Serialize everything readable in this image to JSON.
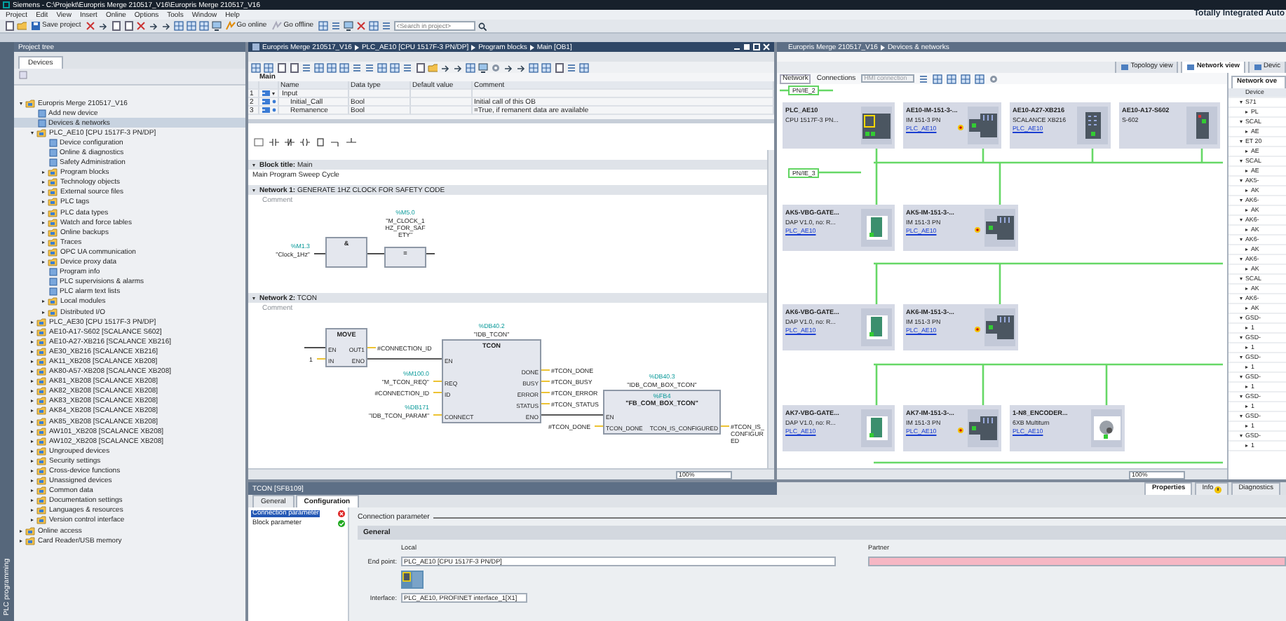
{
  "title_bar": {
    "title": "Siemens - C:\\Projekt\\Europris Merge 210517_V16\\Europris Merge 210517_V16"
  },
  "menu": [
    "Project",
    "Edit",
    "View",
    "Insert",
    "Online",
    "Options",
    "Tools",
    "Window",
    "Help"
  ],
  "brand": "Totally Integrated Auto",
  "toolbar": {
    "save_label": "Save project",
    "online_label": "Go online",
    "offline_label": "Go offline",
    "search_placeholder": "<Search in project>"
  },
  "side_tab": "PLC programming",
  "project_tree": {
    "title": "Project tree",
    "tab": "Devices",
    "items": [
      {
        "label": "Europris Merge 210517_V16",
        "kind": "node",
        "expanded": true,
        "selected": false,
        "children": [
          {
            "label": "Add new device",
            "kind": "leaf",
            "selected": false
          },
          {
            "label": "Devices & networks",
            "kind": "leaf",
            "selected": true
          },
          {
            "label": "PLC_AE10 [CPU 1517F-3 PN/DP]",
            "kind": "node",
            "expanded": true,
            "selected": false,
            "children": [
              {
                "label": "Device configuration",
                "kind": "leaf",
                "selected": false
              },
              {
                "label": "Online & diagnostics",
                "kind": "leaf",
                "selected": false
              },
              {
                "label": "Safety Administration",
                "kind": "leaf",
                "selected": false
              },
              {
                "label": "Program blocks",
                "kind": "node",
                "expanded": false,
                "selected": false
              },
              {
                "label": "Technology objects",
                "kind": "node",
                "expanded": false,
                "selected": false
              },
              {
                "label": "External source files",
                "kind": "node",
                "expanded": false,
                "selected": false
              },
              {
                "label": "PLC tags",
                "kind": "node",
                "expanded": false,
                "selected": false
              },
              {
                "label": "PLC data types",
                "kind": "node",
                "expanded": false,
                "selected": false
              },
              {
                "label": "Watch and force tables",
                "kind": "node",
                "expanded": false,
                "selected": false
              },
              {
                "label": "Online backups",
                "kind": "node",
                "expanded": false,
                "selected": false
              },
              {
                "label": "Traces",
                "kind": "node",
                "expanded": false,
                "selected": false
              },
              {
                "label": "OPC UA communication",
                "kind": "node",
                "expanded": false,
                "selected": false
              },
              {
                "label": "Device proxy data",
                "kind": "node",
                "expanded": false,
                "selected": false
              },
              {
                "label": "Program info",
                "kind": "leaf",
                "selected": false
              },
              {
                "label": "PLC supervisions & alarms",
                "kind": "leaf",
                "selected": false
              },
              {
                "label": "PLC alarm text lists",
                "kind": "leaf",
                "selected": false
              },
              {
                "label": "Local modules",
                "kind": "node",
                "expanded": false,
                "selected": false
              },
              {
                "label": "Distributed I/O",
                "kind": "node",
                "expanded": false,
                "selected": false
              }
            ]
          },
          {
            "label": "PLC_AE30 [CPU 1517F-3 PN/DP]",
            "kind": "node",
            "expanded": false,
            "selected": false
          },
          {
            "label": "AE10-A17-S602 [SCALANCE S602]",
            "kind": "node",
            "expanded": false,
            "selected": false
          },
          {
            "label": "AE10-A27-XB216 [SCALANCE XB216]",
            "kind": "node",
            "expanded": false,
            "selected": false
          },
          {
            "label": "AE30_XB216 [SCALANCE XB216]",
            "kind": "node",
            "expanded": false,
            "selected": false
          },
          {
            "label": "AK11_XB208 [SCALANCE XB208]",
            "kind": "node",
            "expanded": false,
            "selected": false
          },
          {
            "label": "AK80-A57-XB208 [SCALANCE XB208]",
            "kind": "node",
            "expanded": false,
            "selected": false
          },
          {
            "label": "AK81_XB208 [SCALANCE XB208]",
            "kind": "node",
            "expanded": false,
            "selected": false
          },
          {
            "label": "AK82_XB208 [SCALANCE XB208]",
            "kind": "node",
            "expanded": false,
            "selected": false
          },
          {
            "label": "AK83_XB208 [SCALANCE XB208]",
            "kind": "node",
            "expanded": false,
            "selected": false
          },
          {
            "label": "AK84_XB208 [SCALANCE XB208]",
            "kind": "node",
            "expanded": false,
            "selected": false
          },
          {
            "label": "AK85_XB208 [SCALANCE XB208]",
            "kind": "node",
            "expanded": false,
            "selected": false
          },
          {
            "label": "AW101_XB208 [SCALANCE XB208]",
            "kind": "node",
            "expanded": false,
            "selected": false
          },
          {
            "label": "AW102_XB208 [SCALANCE XB208]",
            "kind": "node",
            "expanded": false,
            "selected": false
          },
          {
            "label": "Ungrouped devices",
            "kind": "node",
            "expanded": false,
            "selected": false
          },
          {
            "label": "Security settings",
            "kind": "node",
            "expanded": false,
            "selected": false
          },
          {
            "label": "Cross-device functions",
            "kind": "node",
            "expanded": false,
            "selected": false
          },
          {
            "label": "Unassigned devices",
            "kind": "node",
            "expanded": false,
            "selected": false
          },
          {
            "label": "Common data",
            "kind": "node",
            "expanded": false,
            "selected": false
          },
          {
            "label": "Documentation settings",
            "kind": "node",
            "expanded": false,
            "selected": false
          },
          {
            "label": "Languages & resources",
            "kind": "node",
            "expanded": false,
            "selected": false
          },
          {
            "label": "Version control interface",
            "kind": "node",
            "expanded": false,
            "selected": false
          }
        ]
      },
      {
        "label": "Online access",
        "kind": "node",
        "expanded": false,
        "selected": false
      },
      {
        "label": "Card Reader/USB memory",
        "kind": "node",
        "expanded": false,
        "selected": false
      }
    ]
  },
  "editor": {
    "breadcrumb": [
      "Europris Merge 210517_V16",
      "PLC_AE10 [CPU 1517F-3 PN/DP]",
      "Program blocks",
      "Main [OB1]"
    ],
    "interface": {
      "title": "Main",
      "columns": [
        "Name",
        "Data type",
        "Default value",
        "Comment"
      ],
      "rows": [
        {
          "num": "1",
          "name": "Input",
          "kind": "section",
          "expanded": true
        },
        {
          "num": "2",
          "name": "Initial_Call",
          "kind": "param",
          "data_type": "Bool",
          "comment": "Initial call of this OB"
        },
        {
          "num": "3",
          "name": "Remanence",
          "kind": "param",
          "data_type": "Bool",
          "comment": "=True, if remanent data are available"
        }
      ]
    },
    "block_title": {
      "label": "Block title:",
      "value": "Main",
      "comment": "Main Program Sweep Cycle"
    },
    "networks": [
      {
        "label": "Network 1:",
        "title": "GENERATE 1HZ CLOCK FOR SAFETY CODE",
        "comment": "Comment",
        "kind": "logic",
        "expanded": true,
        "contact": {
          "address": "%M1.3",
          "tag": "\"Clock_1Hz\""
        },
        "gate": "&",
        "coil": {
          "symbol": "=",
          "address": "%M5.0",
          "tag": "\"M_CLOCK_1HZ_FOR_SAFETY\""
        }
      },
      {
        "label": "Network 2:",
        "title": "TCON",
        "comment": "Comment",
        "kind": "blocks",
        "expanded": true,
        "blocks": [
          {
            "title": "MOVE",
            "inputs": [
              {
                "pin": "EN"
              },
              {
                "pin": "IN",
                "value": "1"
              }
            ],
            "outputs": [
              {
                "pin": "OUT1",
                "value": "#CONNECTION_ID"
              },
              {
                "pin": "ENO"
              }
            ]
          },
          {
            "instance_address": "%DB40.2",
            "instance_tag": "\"IDB_TCON\"",
            "title": "TCON",
            "inputs": [
              {
                "pin": "EN"
              },
              {
                "pin": "REQ",
                "address": "%M100.0",
                "value": "\"M_TCON_REQ\""
              },
              {
                "pin": "ID",
                "value": "#CONNECTION_ID"
              },
              {
                "pin": "CONNECT",
                "address": "%DB171",
                "value": "\"IDB_TCON_PARAM\""
              }
            ],
            "outputs": [
              {
                "pin": "DONE",
                "value": "#TCON_DONE"
              },
              {
                "pin": "BUSY",
                "value": "#TCON_BUSY"
              },
              {
                "pin": "ERROR",
                "value": "#TCON_ERROR"
              },
              {
                "pin": "STATUS",
                "value": "#TCON_STATUS"
              },
              {
                "pin": "ENO"
              }
            ]
          },
          {
            "instance_address": "%DB40.3",
            "instance_tag": "\"IDB_COM_BOX_TCON\"",
            "address": "%FB4",
            "title": "\"FB_COM_BOX_TCON\"",
            "inputs": [
              {
                "pin": "EN"
              },
              {
                "pin": "TCON_DONE",
                "value": "#TCON_DONE"
              }
            ],
            "outputs": [
              {
                "pin": "TCON_IS_CONFIGURED",
                "value": "#TCON_IS_CONFIGURED"
              }
            ]
          }
        ]
      }
    ],
    "zoom": "100%"
  },
  "network_view": {
    "breadcrumb": [
      "Europris Merge 210517_V16",
      "Devices & networks"
    ],
    "views": [
      {
        "label": "Topology view",
        "selected": false
      },
      {
        "label": "Network view",
        "selected": true
      },
      {
        "label": "Devic",
        "selected": false
      }
    ],
    "toolbar": {
      "network": "Network",
      "connections": "Connections",
      "connection_type": "HMI connection"
    },
    "subnets": [
      "PN/IE_2",
      "PN/IE_3"
    ],
    "device_rows": [
      [
        {
          "name": "PLC_AE10",
          "type": "CPU 1517F-3 PN...",
          "kind": "cpu",
          "warning": false
        },
        {
          "name": "AE10-IM-151-3-...",
          "type": "IM 151-3 PN",
          "link": "PLC_AE10",
          "kind": "io",
          "warning": true
        },
        {
          "name": "AE10-A27-XB216",
          "type": "SCALANCE XB216",
          "link": "PLC_AE10",
          "kind": "switch",
          "warning": false
        },
        {
          "name": "AE10-A17-S602",
          "type": "S-602",
          "kind": "security",
          "warning": false
        }
      ],
      [
        {
          "name": "AK5-VBG-GATE...",
          "type": "DAP V1.0, no: R...",
          "link": "PLC_AE10",
          "kind": "gateway",
          "warning": false
        },
        {
          "name": "AK5-IM-151-3-...",
          "type": "IM 151-3 PN",
          "link": "PLC_AE10",
          "kind": "io",
          "warning": true
        }
      ],
      [
        {
          "name": "AK6-VBG-GATE...",
          "type": "DAP V1.0, no: R...",
          "link": "PLC_AE10",
          "kind": "gateway",
          "warning": false
        },
        {
          "name": "AK6-IM-151-3-...",
          "type": "IM 151-3 PN",
          "link": "PLC_AE10",
          "kind": "io",
          "warning": true
        }
      ],
      [
        {
          "name": "AK7-VBG-GATE...",
          "type": "DAP V1.0, no: R...",
          "link": "PLC_AE10",
          "kind": "gateway",
          "warning": false
        },
        {
          "name": "AK7-IM-151-3-...",
          "type": "IM 151-3 PN",
          "link": "PLC_AE10",
          "kind": "io",
          "warning": true
        },
        {
          "name": "1-N8_ENCODER...",
          "type": "6XB Multiturn",
          "link": "PLC_AE10",
          "kind": "encoder",
          "warning": false
        }
      ]
    ],
    "zoom": "100%",
    "overview": {
      "title": "Network ove",
      "column": "Device",
      "items": [
        {
          "name": "S71",
          "expanded": true,
          "children": [
            {
              "name": "PL"
            }
          ]
        },
        {
          "name": "SCAL",
          "expanded": true,
          "children": [
            {
              "name": "AE"
            }
          ]
        },
        {
          "name": "ET 20",
          "expanded": true,
          "children": [
            {
              "name": "AE"
            }
          ]
        },
        {
          "name": "SCAL",
          "expanded": true,
          "children": [
            {
              "name": "AE"
            }
          ]
        },
        {
          "name": "AK5-",
          "expanded": true,
          "children": [
            {
              "name": "AK"
            }
          ]
        },
        {
          "name": "AK6-",
          "expanded": true,
          "children": [
            {
              "name": "AK"
            }
          ]
        },
        {
          "name": "AK6-",
          "expanded": true,
          "children": [
            {
              "name": "AK"
            }
          ]
        },
        {
          "name": "AK6-",
          "expanded": true,
          "children": [
            {
              "name": "AK"
            }
          ]
        },
        {
          "name": "AK6-",
          "expanded": true,
          "children": [
            {
              "name": "AK"
            }
          ]
        },
        {
          "name": "SCAL",
          "expanded": true,
          "children": [
            {
              "name": "AK"
            }
          ]
        },
        {
          "name": "AK6-",
          "expanded": true,
          "children": [
            {
              "name": "AK"
            }
          ]
        },
        {
          "name": "GSD-",
          "expanded": true,
          "children": [
            {
              "name": "1"
            }
          ]
        },
        {
          "name": "GSD-",
          "expanded": true,
          "children": [
            {
              "name": "1"
            }
          ]
        },
        {
          "name": "GSD-",
          "expanded": true,
          "children": [
            {
              "name": "1"
            }
          ]
        },
        {
          "name": "GSD-",
          "expanded": true,
          "children": [
            {
              "name": "1"
            }
          ]
        },
        {
          "name": "GSD-",
          "expanded": true,
          "children": [
            {
              "name": "1"
            }
          ]
        },
        {
          "name": "GSD-",
          "expanded": true,
          "children": [
            {
              "name": "1"
            }
          ]
        },
        {
          "name": "GSD-",
          "expanded": true,
          "children": [
            {
              "name": "1"
            }
          ]
        }
      ]
    }
  },
  "properties": {
    "title": "TCON [SFB109]",
    "tabs": [
      {
        "label": "General",
        "selected": false
      },
      {
        "label": "Configuration",
        "selected": true
      }
    ],
    "inspector_tabs": [
      {
        "label": "Properties",
        "selected": true,
        "alert": false
      },
      {
        "label": "Info",
        "selected": false,
        "alert": true
      },
      {
        "label": "Diagnostics",
        "selected": false,
        "alert": false
      }
    ],
    "nav": [
      {
        "label": "Connection parameter",
        "selected": true,
        "error": true
      },
      {
        "label": "Block parameter",
        "selected": false,
        "error": false
      }
    ],
    "heading": "Connection parameter",
    "group": "General",
    "local": {
      "label": "Local",
      "endpoint_label": "End point:",
      "endpoint": "PLC_AE10 [CPU 1517F-3 PN/DP]",
      "interface_label": "Interface:",
      "interface": "PLC_AE10, PROFINET interface_1[X1]"
    },
    "partner": {
      "label": "Partner",
      "invalid": true
    }
  }
}
